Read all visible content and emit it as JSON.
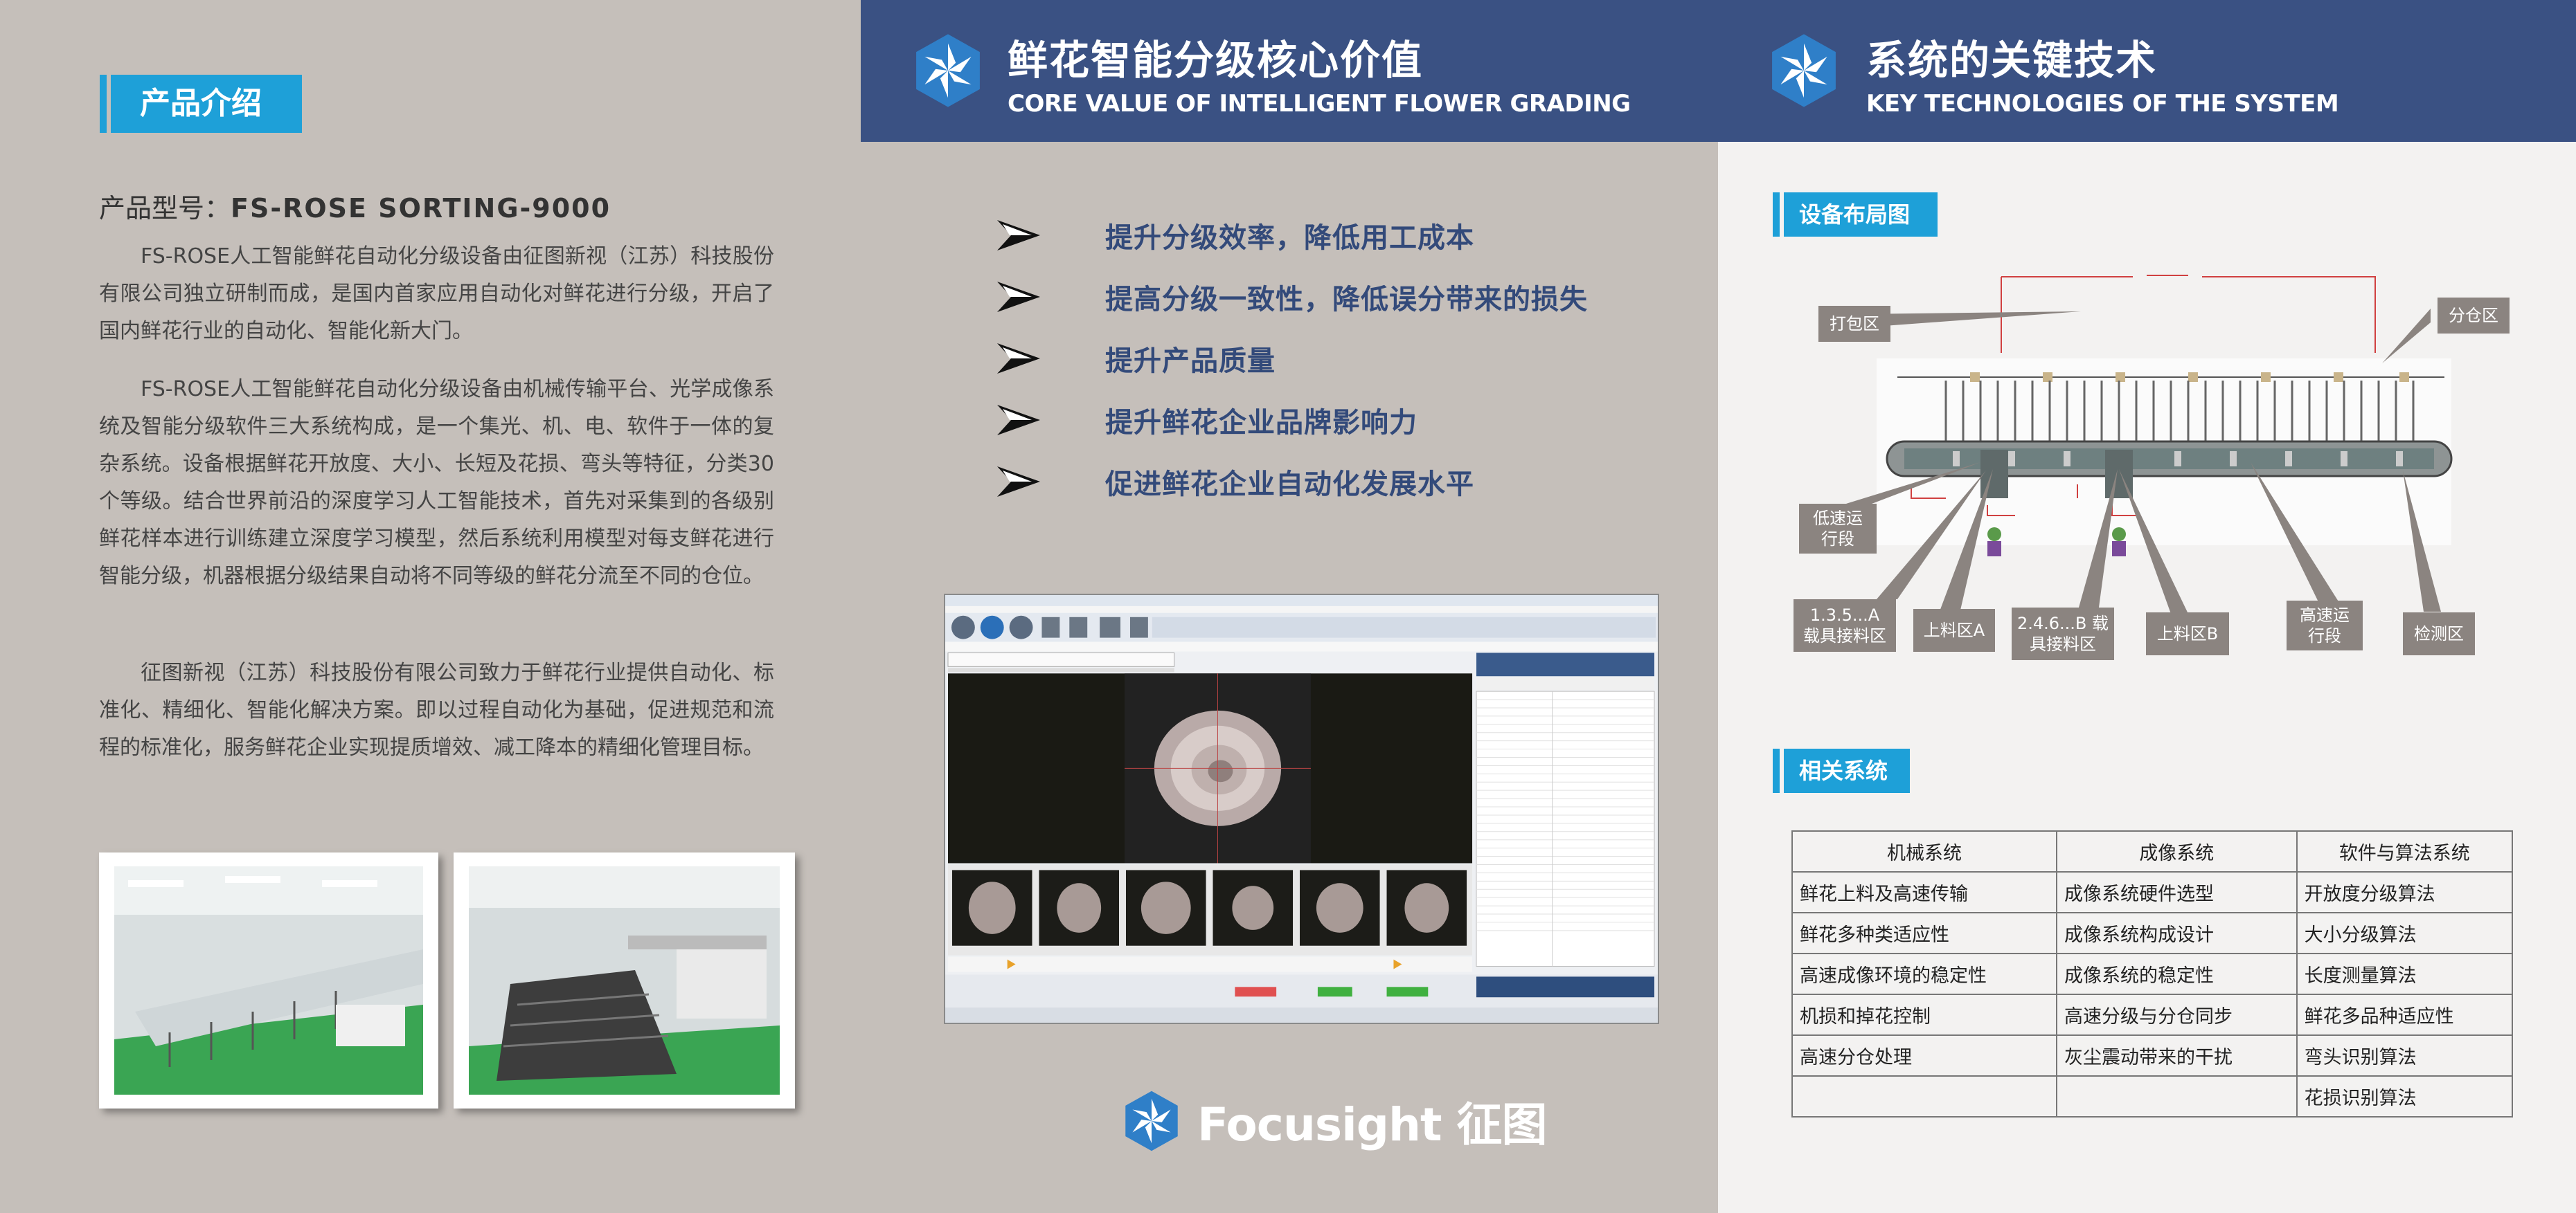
{
  "left": {
    "section_title": "产品介绍",
    "model_label": "产品型号：",
    "model_value": "FS-ROSE SORTING-9000",
    "paragraphs": [
      "FS-ROSE人工智能鲜花自动化分级设备由征图新视（江苏）科技股份有限公司独立研制而成，是国内首家应用自动化对鲜花进行分级，开启了国内鲜花行业的自动化、智能化新大门。",
      "FS-ROSE人工智能鲜花自动化分级设备由机械传输平台、光学成像系统及智能分级软件三大系统构成，是一个集光、机、电、软件于一体的复杂系统。设备根据鲜花开放度、大小、长短及花损、弯头等特征，分类30个等级。结合世界前沿的深度学习人工智能技术，首先对采集到的各级别鲜花样本进行训练建立深度学习模型，然后系统利用模型对每支鲜花进行智能分级，机器根据分级结果自动将不同等级的鲜花分流至不同的仓位。",
      "征图新视（江苏）科技股份有限公司致力于鲜花行业提供自动化、标准化、精细化、智能化解决方案。即以过程自动化为基础，促进规范和流程的标准化，服务鲜花企业实现提质增效、减工降本的精细化管理目标。"
    ]
  },
  "middle": {
    "title_zh": "鲜花智能分级核心价值",
    "title_en": "CORE VALUE OF INTELLIGENT FLOWER GRADING",
    "bullets": [
      "提升分级效率，降低用工成本",
      "提高分级一致性，降低误分带来的损失",
      "提升产品质量",
      "提升鲜花企业品牌影响力",
      "促进鲜花企业自动化发展水平"
    ],
    "brand_name": "Focusight 征图"
  },
  "right": {
    "title_zh": "系统的关键技术",
    "title_en": "KEY TECHNOLOGIES OF THE SYSTEM",
    "layout_title": "设备布局图",
    "callouts": {
      "packing": "打包区",
      "binning": "分仓区",
      "low_speed": "低速运\n行段",
      "carrier_a": "1.3.5...A\n载具接料区",
      "loading_a": "上料区A",
      "carrier_b": "2.4.6...B 载\n具接料区",
      "loading_b": "上料区B",
      "high_speed": "高速运\n行段",
      "inspection": "检测区"
    },
    "systems_title": "相关系统",
    "table": {
      "headers": [
        "机械系统",
        "成像系统",
        "软件与算法系统"
      ],
      "rows": [
        [
          "鲜花上料及高速传输",
          "成像系统硬件选型",
          "开放度分级算法"
        ],
        [
          "鲜花多种类适应性",
          "成像系统构成设计",
          "大小分级算法"
        ],
        [
          "高速成像环境的稳定性",
          "成像系统的稳定性",
          "长度测量算法"
        ],
        [
          "机损和掉花控制",
          "高速分级与分仓同步",
          "鲜花多品种适应性"
        ],
        [
          "高速分仓处理",
          "灰尘震动带来的干扰",
          "弯头识别算法"
        ],
        [
          "",
          "",
          "花损识别算法"
        ]
      ]
    }
  },
  "colors": {
    "band": "#3a5183",
    "accent": "#1ea0d8",
    "bullet_text": "#334a7a",
    "background": "#c5bfba",
    "right_background": "#f3f2f1"
  },
  "icons": [
    "focusight-logo-icon",
    "arrow-bullet-icon"
  ]
}
